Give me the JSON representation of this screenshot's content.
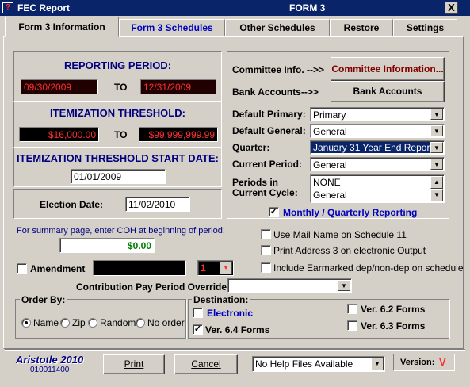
{
  "window": {
    "title": "FEC Report",
    "form": "FORM 3",
    "close": "X",
    "app_icon": "?"
  },
  "tabs": [
    {
      "label": "Form 3 Information",
      "active": true
    },
    {
      "label": "Form 3 Schedules"
    },
    {
      "label": "Other Schedules"
    },
    {
      "label": "Restore"
    },
    {
      "label": "Settings"
    }
  ],
  "reporting": {
    "title": "REPORTING PERIOD:",
    "from": "09/30/2009",
    "to_label": "TO",
    "to": "12/31/2009"
  },
  "itemization": {
    "title": "ITEMIZATION THRESHOLD:",
    "from": "$16,000.00",
    "to_label": "TO",
    "to": "$99,999,999.99"
  },
  "threshold_start": {
    "title": "ITEMIZATION THRESHOLD START DATE:",
    "value": "01/01/2009"
  },
  "election": {
    "label": "Election Date:",
    "value": "11/02/2010"
  },
  "right": {
    "committee_label": "Committee Info. -->>",
    "committee_button": "Committee Information...",
    "bank_label": "Bank Accounts-->>",
    "bank_button": "Bank Accounts",
    "default_primary_label": "Default Primary:",
    "default_primary_value": "Primary",
    "default_general_label": "Default General:",
    "default_general_value": "General",
    "quarter_label": "Quarter:",
    "quarter_value": "January 31 Year End Report",
    "current_period_label": "Current Period:",
    "current_period_value": "General",
    "periods_label": "Periods in Current Cycle:",
    "periods": [
      "NONE",
      "General"
    ],
    "monthly_label": "Monthly / Quarterly Reporting",
    "monthly_checked": true
  },
  "coh": {
    "label": "For summary page, enter COH at beginning of period:",
    "value": "$0.00"
  },
  "options": [
    {
      "label": "Use Mail Name on Schedule 11",
      "checked": false
    },
    {
      "label": "Print Address 3 on electronic Output",
      "checked": false
    },
    {
      "label": "Include Earmarked dep/non-dep on schedule",
      "checked": false
    }
  ],
  "amendment": {
    "label": "Amendment",
    "checked": false,
    "number": "1"
  },
  "override": {
    "label": "Contribution Pay Period Override:",
    "value": ""
  },
  "order_by": {
    "title": "Order By:",
    "options": [
      "Name",
      "Zip",
      "Random",
      "No order"
    ],
    "selected": "Name"
  },
  "destination": {
    "title": "Destination:",
    "electronic": {
      "label": "Electronic",
      "checked": false
    },
    "v64": {
      "label": "Ver. 6.4 Forms",
      "checked": true
    },
    "v62": {
      "label": "Ver. 6.2 Forms",
      "checked": false
    },
    "v63": {
      "label": "Ver. 6.3 Forms",
      "checked": false
    }
  },
  "footer": {
    "brand": "Aristotle 2010",
    "code": "010011400",
    "print": "Print",
    "cancel": "Cancel",
    "help": "No Help Files Available",
    "version_label": "Version:",
    "version_mark": "V"
  },
  "colors": {
    "title_bar": "#0a246a",
    "red_text": "#ff3030",
    "navy_text": "#000080",
    "blue_tab": "#0000c0"
  }
}
